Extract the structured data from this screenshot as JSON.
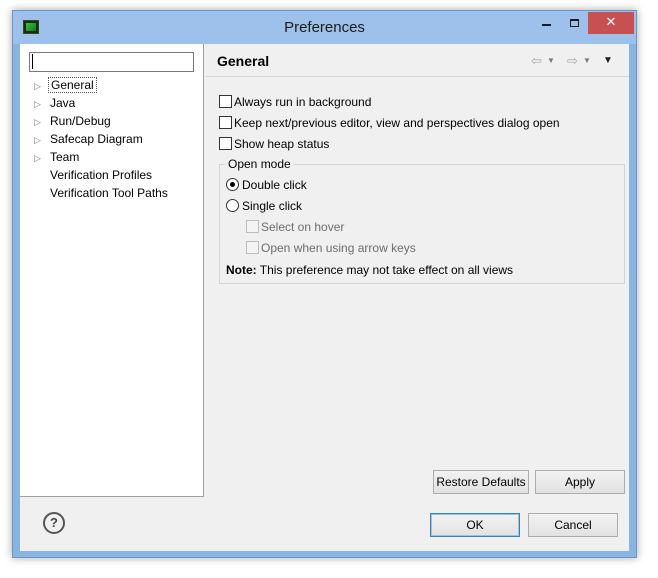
{
  "window": {
    "title": "Preferences",
    "close_glyph": "✕",
    "minimize_icon": "minimize-icon",
    "maximize_icon": "maximize-icon"
  },
  "sidebar": {
    "filter": {
      "value": "",
      "placeholder": ""
    },
    "items": [
      {
        "label": "General",
        "expandable": true,
        "selected": true
      },
      {
        "label": "Java",
        "expandable": true,
        "selected": false
      },
      {
        "label": "Run/Debug",
        "expandable": true,
        "selected": false
      },
      {
        "label": "Safecap Diagram",
        "expandable": true,
        "selected": false
      },
      {
        "label": "Team",
        "expandable": true,
        "selected": false
      },
      {
        "label": "Verification Profiles",
        "expandable": false,
        "selected": false
      },
      {
        "label": "Verification Tool Paths",
        "expandable": false,
        "selected": false
      }
    ]
  },
  "page": {
    "title": "General",
    "nav": {
      "back_glyph": "⇦",
      "forward_glyph": "⇨",
      "dropdown_glyph": "▼",
      "view_menu_glyph": "▼"
    },
    "options": [
      {
        "label": "Always run in background",
        "checked": false
      },
      {
        "label": "Keep next/previous editor, view and perspectives dialog open",
        "checked": false
      },
      {
        "label": "Show heap status",
        "checked": false
      }
    ],
    "open_mode": {
      "legend": "Open mode",
      "radios": [
        {
          "label": "Double click",
          "selected": true
        },
        {
          "label": "Single click",
          "selected": false
        }
      ],
      "sub_options": [
        {
          "label": "Select on hover",
          "checked": false,
          "enabled": false
        },
        {
          "label": "Open when using arrow keys",
          "checked": false,
          "enabled": false
        }
      ],
      "note_label": "Note:",
      "note_text": "This preference may not take effect on all views"
    },
    "buttons": {
      "restore_defaults": "Restore Defaults",
      "apply": "Apply"
    }
  },
  "footer": {
    "help_glyph": "?",
    "ok": "OK",
    "cancel": "Cancel"
  },
  "colors": {
    "title_bar": "#9dc1ea",
    "close_button": "#c75050",
    "dialog_bg": "#f0f0f0"
  }
}
